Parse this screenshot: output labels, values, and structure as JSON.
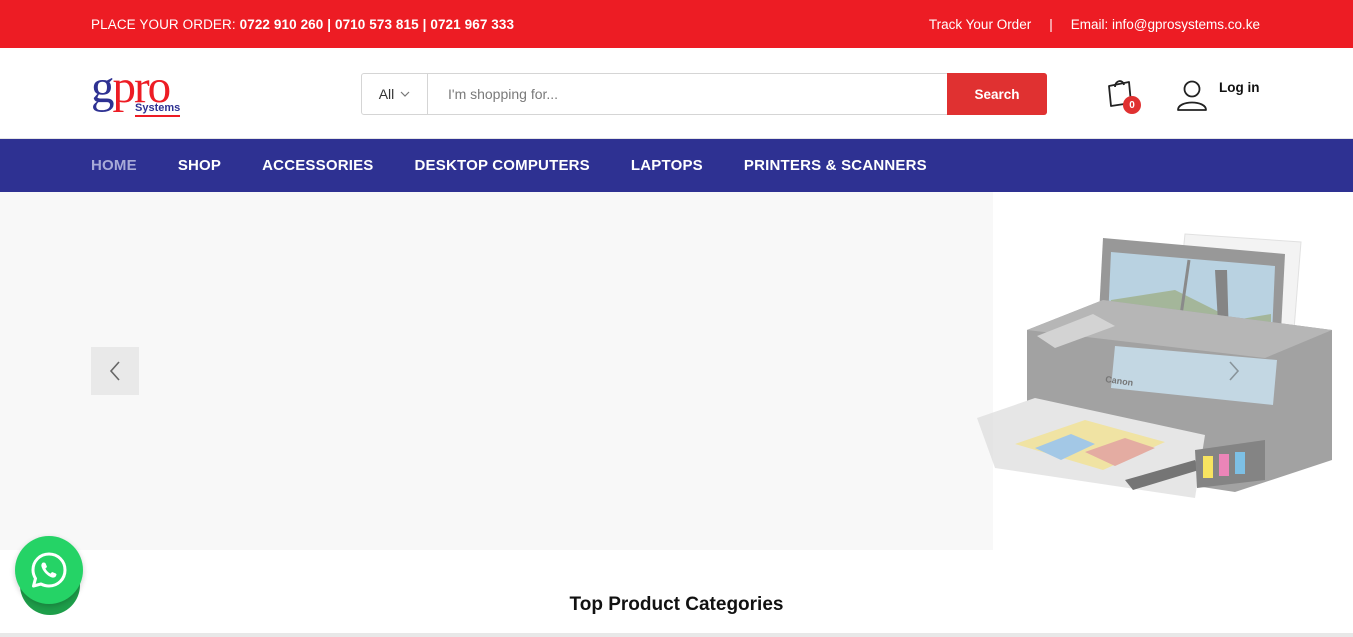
{
  "topbar": {
    "order_prefix": "PLACE YOUR ORDER:",
    "phones": "0722 910 260 | 0710 573 815 | 0721 967 333",
    "track_order": "Track Your Order",
    "separator": "|",
    "email": "Email: info@gprosystems.co.ke",
    "background": "#ed1c24"
  },
  "logo": {
    "g": "g",
    "pro": "pro",
    "systems": "Systems"
  },
  "search": {
    "category": "All",
    "placeholder": "I'm shopping for...",
    "button": "Search"
  },
  "cart": {
    "count": "0",
    "icon": "shopping-bag-icon"
  },
  "account": {
    "login_label": "Log in",
    "icon": "user-icon"
  },
  "nav": {
    "background": "#2e3192",
    "items": [
      {
        "label": "HOME",
        "active": true
      },
      {
        "label": "SHOP"
      },
      {
        "label": "ACCESSORIES"
      },
      {
        "label": "DESKTOP COMPUTERS"
      },
      {
        "label": "LAPTOPS"
      },
      {
        "label": "PRINTERS & SCANNERS"
      }
    ]
  },
  "hero": {
    "prev_icon": "chevron-left-icon",
    "next_icon": "chevron-right-icon"
  },
  "sections": {
    "top_categories_title": "Top Product Categories"
  },
  "whatsapp": {
    "icon": "whatsapp-icon",
    "color": "#25d366"
  }
}
